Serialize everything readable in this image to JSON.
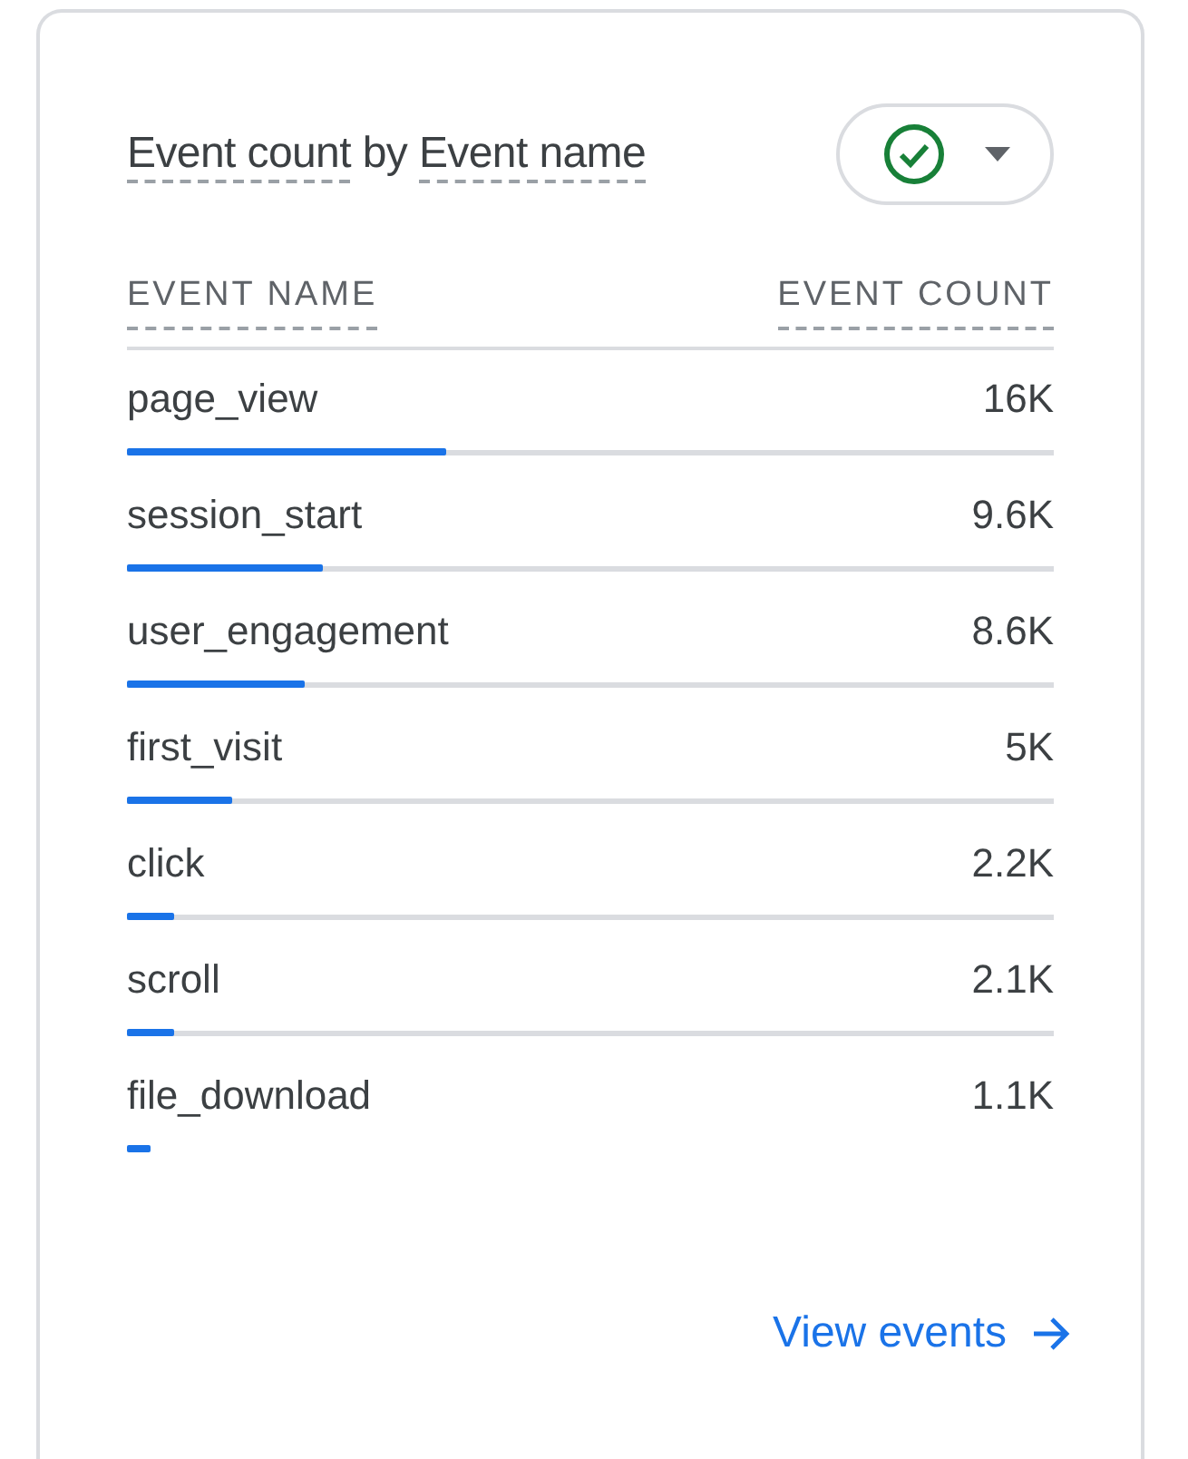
{
  "card": {
    "title": [
      {
        "text": "Event count",
        "underlined": true
      },
      {
        "text": "by",
        "underlined": false
      },
      {
        "text": "Event name",
        "underlined": true
      }
    ],
    "table": {
      "columns": [
        "EVENT NAME",
        "EVENT COUNT"
      ],
      "rows": [
        {
          "name": "page_view",
          "count": "16K",
          "level": 0.344,
          "track": true
        },
        {
          "name": "session_start",
          "count": "9.6K",
          "level": 0.211,
          "track": true
        },
        {
          "name": "user_engagement",
          "count": "8.6K",
          "level": 0.192,
          "track": true
        },
        {
          "name": "first_visit",
          "count": "5K",
          "level": 0.113,
          "track": true
        },
        {
          "name": "click",
          "count": "2.2K",
          "level": 0.051,
          "track": true
        },
        {
          "name": "scroll",
          "count": "2.1K",
          "level": 0.051,
          "track": true
        },
        {
          "name": "file_download",
          "count": "1.1K",
          "track": false
        }
      ]
    },
    "link": {
      "label": "View events"
    }
  }
}
